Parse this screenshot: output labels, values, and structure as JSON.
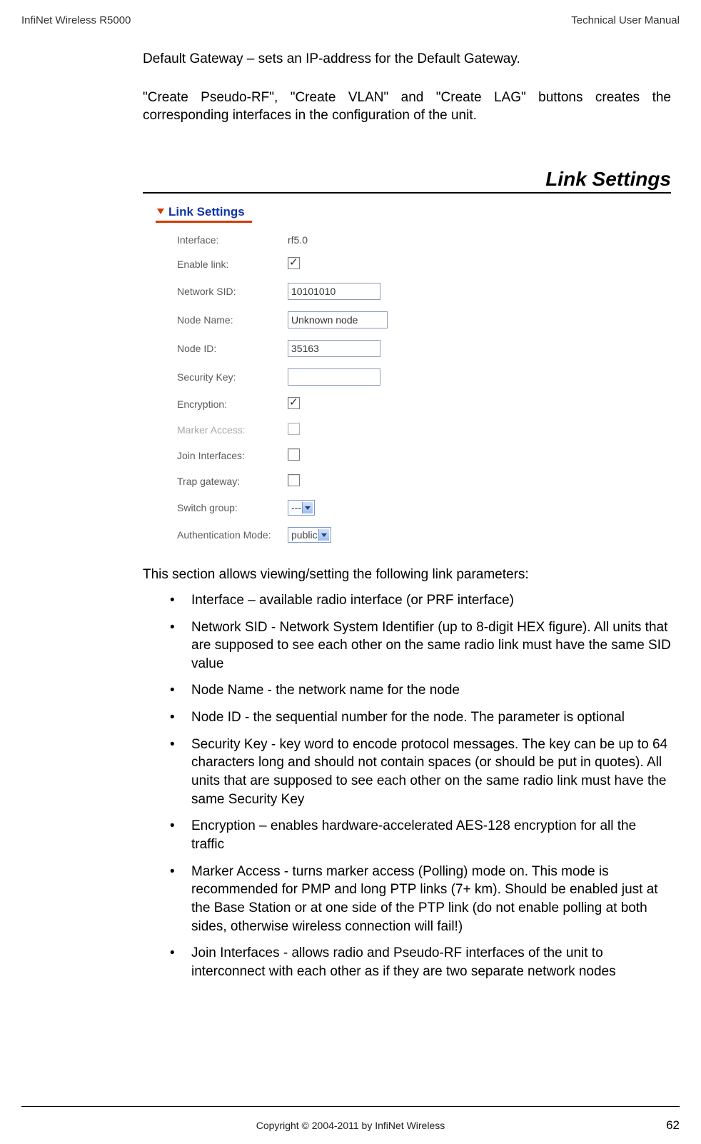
{
  "header": {
    "left": "InfiNet Wireless R5000",
    "right": "Technical User Manual"
  },
  "intro_paragraphs": {
    "p1": "Default Gateway – sets an IP-address for the Default Gateway.",
    "p2": "\"Create Pseudo-RF\", \"Create VLAN\" and \"Create LAG\" buttons creates the corresponding interfaces in the configuration of the unit."
  },
  "section_title": "Link Settings",
  "panel": {
    "title": "Link Settings",
    "rows": {
      "interface": {
        "label": "Interface:",
        "value": "rf5.0",
        "type": "text"
      },
      "enable_link": {
        "label": "Enable link:",
        "checked": true,
        "type": "checkbox"
      },
      "network_sid": {
        "label": "Network SID:",
        "value": "10101010",
        "type": "input"
      },
      "node_name": {
        "label": "Node Name:",
        "value": "Unknown node",
        "type": "input"
      },
      "node_id": {
        "label": "Node ID:",
        "value": "35163",
        "type": "input"
      },
      "security_key": {
        "label": "Security Key:",
        "value": "",
        "type": "input"
      },
      "encryption": {
        "label": "Encryption:",
        "checked": true,
        "type": "checkbox"
      },
      "marker_access": {
        "label": "Marker Access:",
        "checked": false,
        "type": "checkbox",
        "faded": true
      },
      "join_interfaces": {
        "label": "Join Interfaces:",
        "checked": false,
        "type": "checkbox"
      },
      "trap_gateway": {
        "label": "Trap gateway:",
        "checked": false,
        "type": "checkbox"
      },
      "switch_group": {
        "label": "Switch group:",
        "value": "---",
        "type": "select"
      },
      "auth_mode": {
        "label": "Authentication Mode:",
        "value": "public",
        "type": "select"
      }
    }
  },
  "list_intro": "This section allows viewing/setting the following link parameters:",
  "bullets": {
    "b1": "Interface – available radio interface (or PRF interface)",
    "b2": "Network SID - Network System Identifier (up to 8-digit HEX figure). All units that are supposed to see each other on the same radio link must have the same SID value",
    "b3": "Node Name - the network name for the node",
    "b4": "Node ID - the sequential number for the node. The parameter is optional",
    "b5": "Security Key - key word to encode protocol messages. The key can be up to 64 characters long and should not contain spaces (or should be put in quotes). All units that are supposed to see each other on the same radio link must have the same Security Key",
    "b6": "Encryption – enables hardware-accelerated AES-128 encryption for all the traffic",
    "b7": "Marker Access - turns marker access (Polling) mode on. This mode is recommended for PMP and long PTP links (7+ km). Should be enabled just at the Base Station or at one side of the PTP link (do not enable polling at both sides, otherwise wireless connection will fail!)",
    "b8": "Join Interfaces - allows radio and Pseudo-RF interfaces of the unit to interconnect with each other as if they are two separate network nodes"
  },
  "footer": {
    "copyright": "Copyright ©  2004-2011 by InfiNet Wireless",
    "page": "62"
  }
}
